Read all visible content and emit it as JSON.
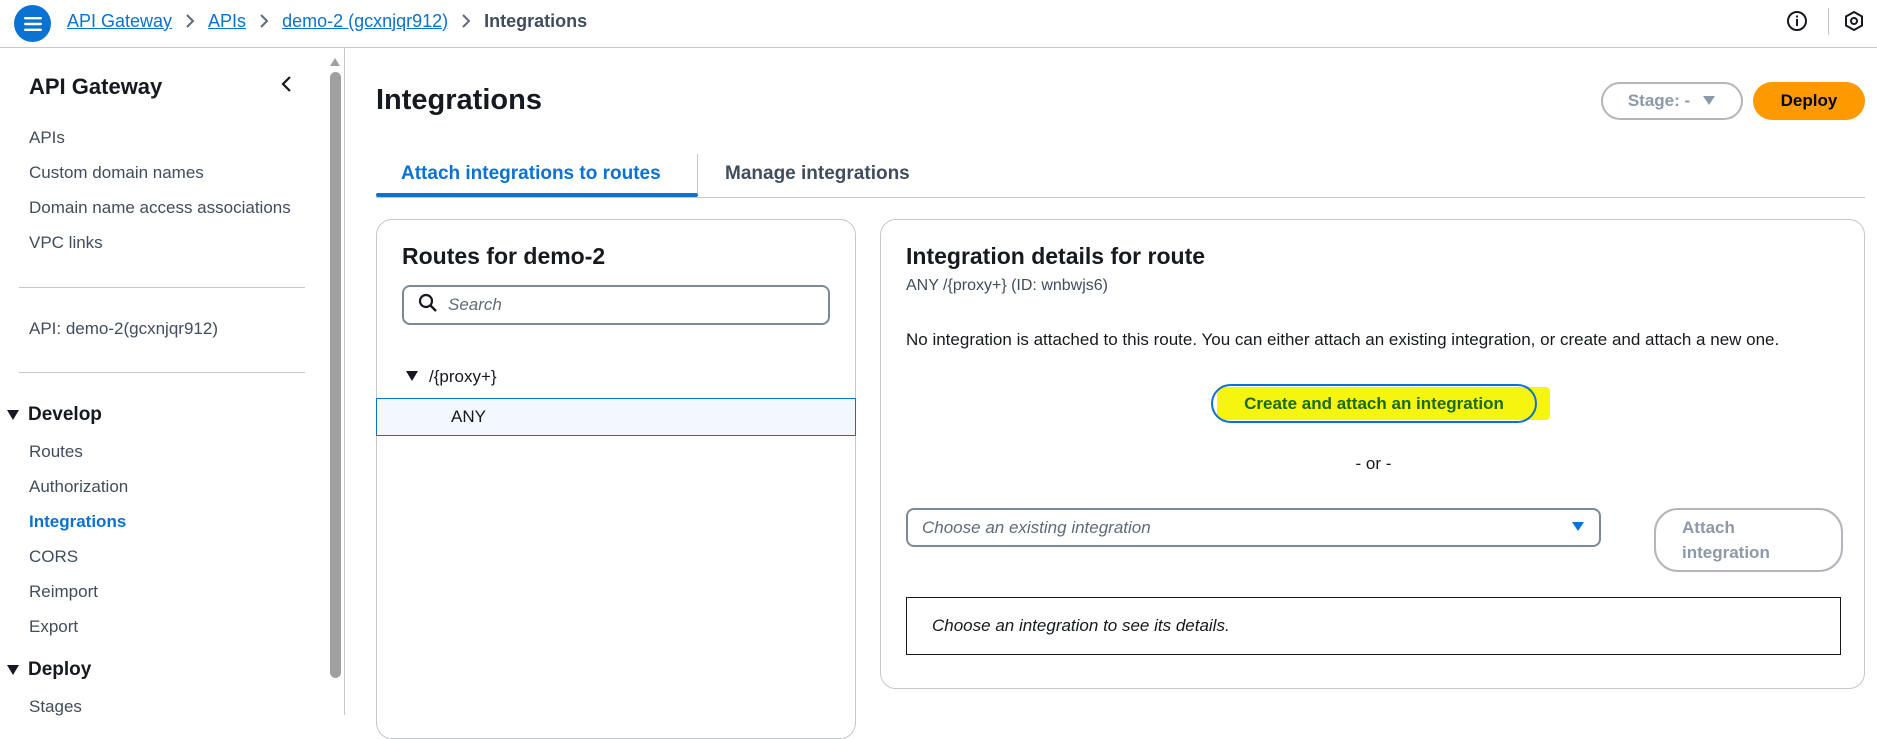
{
  "colors": {
    "accent": "#0972d3",
    "deploy": "#ff9900",
    "highlight": "#f5f50f"
  },
  "header": {
    "menu_icon": "hamburger-menu-icon",
    "breadcrumbs": [
      "API Gateway",
      "APIs",
      "demo-2 (gcxnjqr912)"
    ],
    "current": "Integrations"
  },
  "sidebar": {
    "title": "API Gateway",
    "items": [
      "APIs",
      "Custom domain names",
      "Domain name access associations",
      "VPC links"
    ],
    "api_label": "API: demo-2(gcxnjqr912)",
    "develop": {
      "heading": "Develop",
      "items": [
        "Routes",
        "Authorization",
        "Integrations",
        "CORS",
        "Reimport",
        "Export"
      ]
    },
    "deploy": {
      "heading": "Deploy",
      "items": [
        "Stages"
      ]
    }
  },
  "main": {
    "title": "Integrations",
    "stage_label": "Stage: -",
    "deploy_label": "Deploy",
    "tabs": [
      {
        "label": "Attach integrations to routes"
      },
      {
        "label": "Manage integrations"
      }
    ]
  },
  "routes": {
    "title": "Routes for demo-2",
    "search_placeholder": "Search",
    "path": "/{proxy+}",
    "method": "ANY"
  },
  "details": {
    "title": "Integration details for route",
    "subtitle": "ANY /{proxy+} (ID: wnbwjs6)",
    "message": "No integration is attached to this route. You can either attach an existing integration, or create and attach a new one.",
    "create_label": "Create and attach an integration",
    "or_label": "- or -",
    "select_placeholder": "Choose an existing integration",
    "attach_line1": "Attach",
    "attach_line2": "integration",
    "info_text": "Choose an integration to see its details."
  }
}
